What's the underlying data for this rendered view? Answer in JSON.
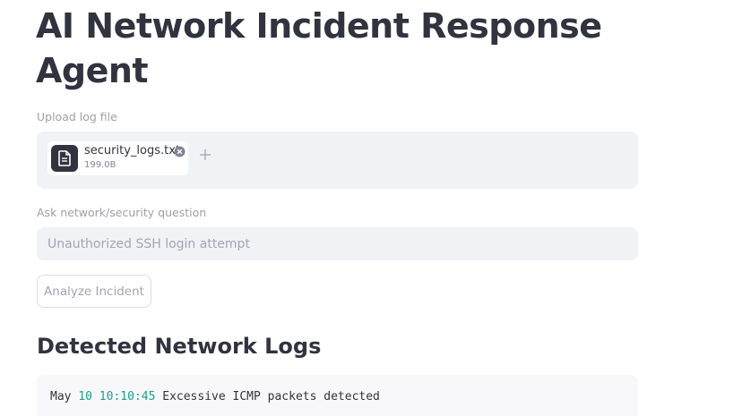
{
  "header": {
    "title": "AI Network Incident Response Agent"
  },
  "upload": {
    "label": "Upload log file",
    "file_name": "security_logs.txt",
    "file_size": "199.0B"
  },
  "question": {
    "label": "Ask network/security question",
    "value": "Unauthorized SSH login attempt"
  },
  "actions": {
    "analyze_label": "Analyze Incident"
  },
  "logs": {
    "heading": "Detected Network Logs",
    "lines": [
      {
        "month": "May",
        "day": "10",
        "time": "10:10:45",
        "message": "Excessive ICMP packets detected"
      }
    ]
  },
  "colors": {
    "text": "#31333f",
    "muted": "#a3a6b0",
    "input_bg": "#f0f2f6",
    "code_number": "#1d9f8e"
  }
}
